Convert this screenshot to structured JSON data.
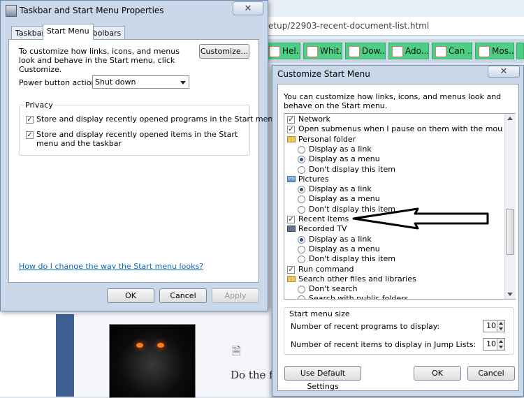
{
  "browser": {
    "address": "etup/22903-recent-document-list.html",
    "bookmarks": [
      "Hel...",
      "Whit...",
      "Dow...",
      "Ado...",
      "Can ...",
      "Mos..."
    ],
    "page_text": "Do the f"
  },
  "taskbar_props": {
    "title": "Taskbar and Start Menu Properties",
    "close_label": "✕",
    "tabs": [
      "Taskbar",
      "Start Menu",
      "Toolbars"
    ],
    "intro": "To customize how links, icons, and menus look and behave in the Start menu, click Customize.",
    "customize_label": "Customize...",
    "power_label": "Power button action:",
    "power_value": "Shut down",
    "privacy_heading": "Privacy",
    "privacy_items": [
      "Store and display recently opened programs in the Start menu",
      "Store and display recently opened items in the Start menu and the taskbar"
    ],
    "help_link": "How do I change the way the Start menu looks?",
    "ok": "OK",
    "cancel": "Cancel",
    "apply": "Apply"
  },
  "customize": {
    "title": "Customize Start Menu",
    "close_label": "✕",
    "intro": "You can customize how links, icons, and menus look and behave on the Start menu.",
    "items": [
      {
        "kind": "check",
        "label": "Network",
        "checked": true
      },
      {
        "kind": "check",
        "label": "Open submenus when I pause on them with the mouse pointer",
        "checked": true
      },
      {
        "kind": "folder",
        "label": "Personal folder"
      },
      {
        "kind": "radio",
        "label": "Display as a link",
        "checked": false
      },
      {
        "kind": "radio",
        "label": "Display as a menu",
        "checked": true
      },
      {
        "kind": "radio",
        "label": "Don't display this item",
        "checked": false
      },
      {
        "kind": "pictures",
        "label": "Pictures"
      },
      {
        "kind": "radio",
        "label": "Display as a link",
        "checked": true
      },
      {
        "kind": "radio",
        "label": "Display as a menu",
        "checked": false
      },
      {
        "kind": "radio",
        "label": "Don't display this item",
        "checked": false
      },
      {
        "kind": "check",
        "label": "Recent Items",
        "checked": true
      },
      {
        "kind": "tv",
        "label": "Recorded TV"
      },
      {
        "kind": "radio",
        "label": "Display as a link",
        "checked": true
      },
      {
        "kind": "radio",
        "label": "Display as a menu",
        "checked": false
      },
      {
        "kind": "radio",
        "label": "Don't display this item",
        "checked": false
      },
      {
        "kind": "check",
        "label": "Run command",
        "checked": true
      },
      {
        "kind": "folder",
        "label": "Search other files and libraries"
      },
      {
        "kind": "radio",
        "label": "Don't search",
        "checked": false
      },
      {
        "kind": "radio",
        "label": "Search with public folders",
        "checked": false
      }
    ],
    "size_heading": "Start menu size",
    "recent_programs_label": "Number of recent programs to display:",
    "recent_programs_value": "10",
    "jump_list_label": "Number of recent items to display in Jump Lists:",
    "jump_list_value": "10",
    "defaults_label": "Use Default Settings",
    "ok": "OK",
    "cancel": "Cancel"
  }
}
